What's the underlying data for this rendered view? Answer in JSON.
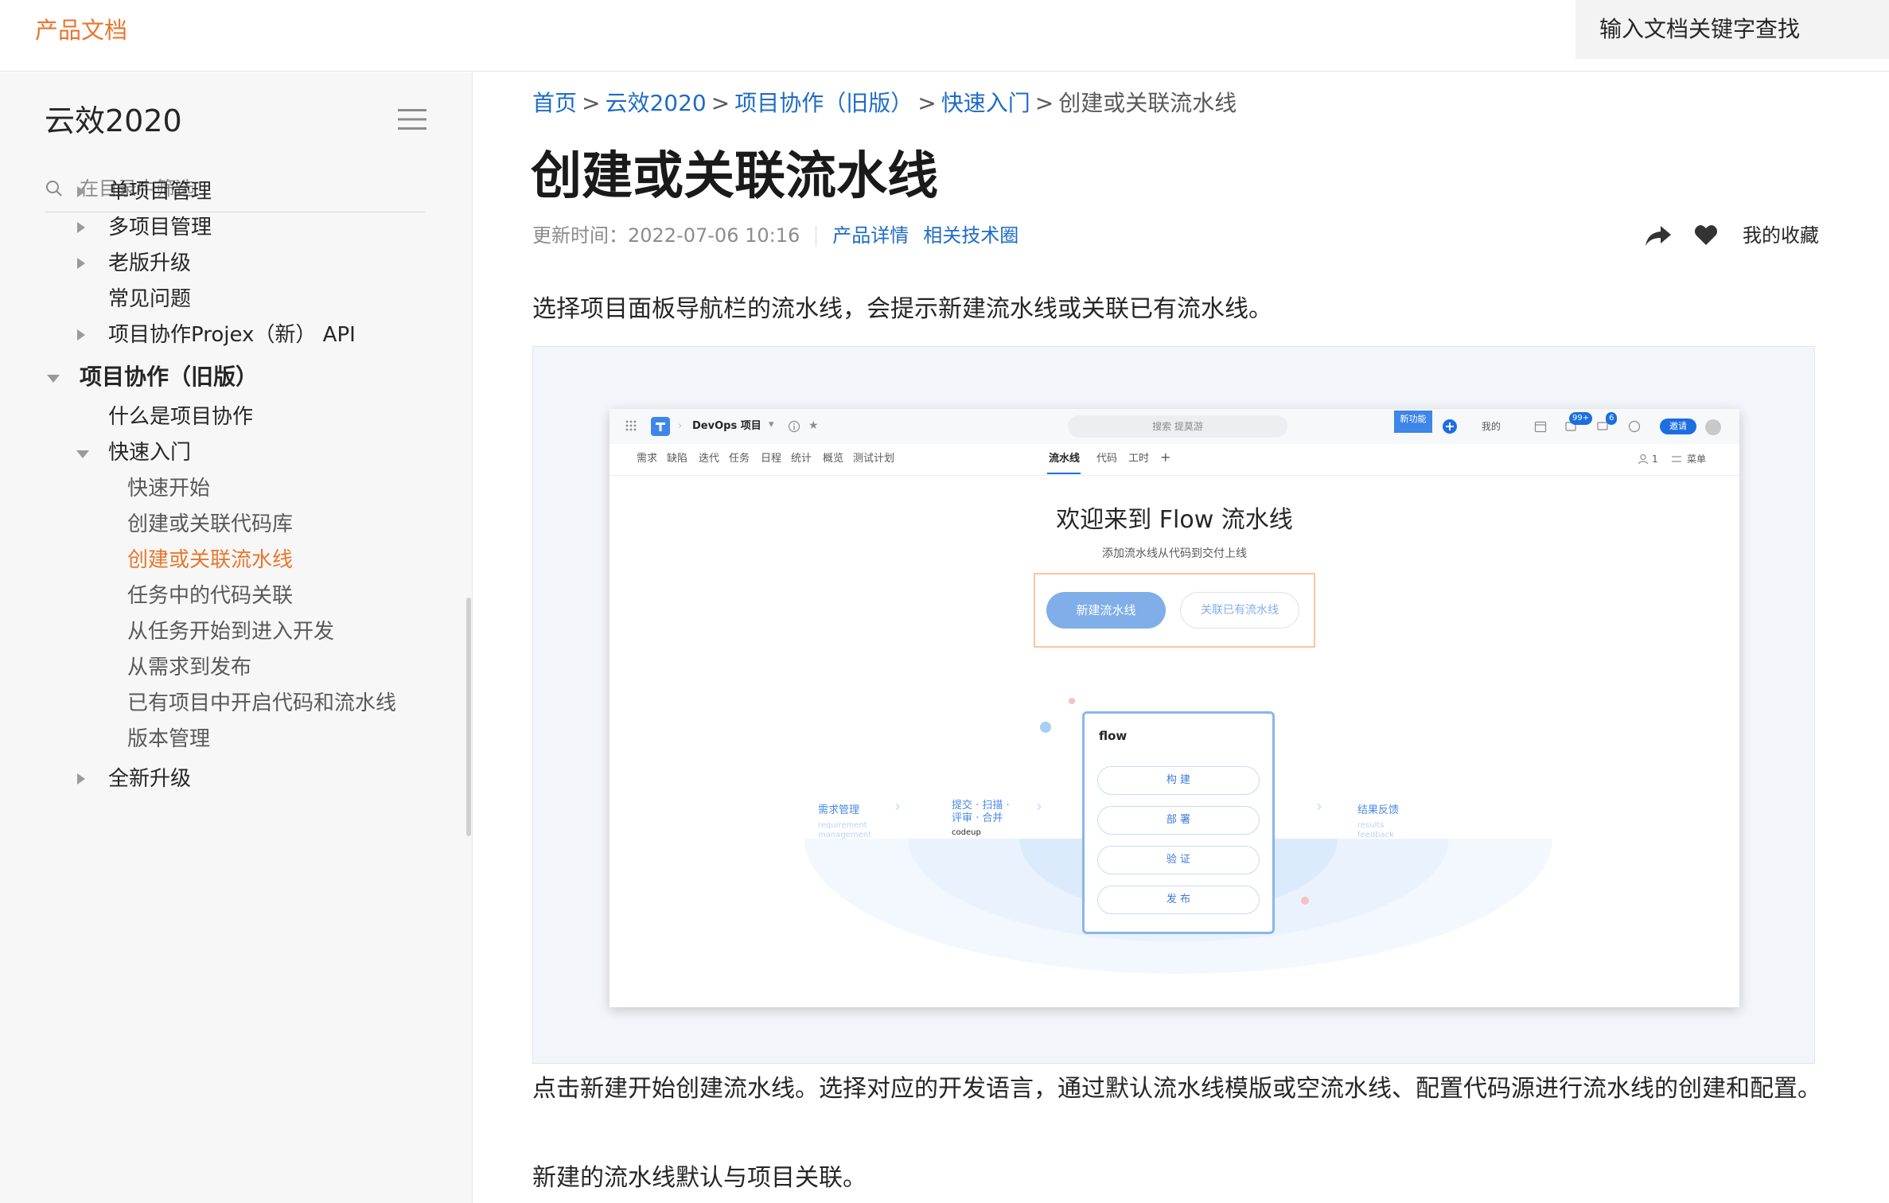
{
  "topbar": {
    "brand": "产品文档",
    "search_placeholder": "输入文档关键字查找"
  },
  "sidebar": {
    "title": "云效2020",
    "filter_placeholder": "在目录中筛选",
    "items": [
      {
        "label": "单项目管理"
      },
      {
        "label": "多项目管理"
      },
      {
        "label": "老版升级"
      },
      {
        "label": "常见问题"
      },
      {
        "label": "项目协作Projex（新） API"
      },
      {
        "label": "项目协作（旧版）"
      },
      {
        "label": "什么是项目协作"
      },
      {
        "label": "快速入门"
      },
      {
        "label": "快速开始"
      },
      {
        "label": "创建或关联代码库"
      },
      {
        "label": "创建或关联流水线"
      },
      {
        "label": "任务中的代码关联"
      },
      {
        "label": "从任务开始到进入开发"
      },
      {
        "label": "从需求到发布"
      },
      {
        "label": "已有项目中开启代码和流水线"
      },
      {
        "label": "版本管理"
      },
      {
        "label": "全新升级"
      }
    ]
  },
  "breadcrumb": {
    "home": "首页",
    "level1": "云效2020",
    "level2": "项目协作（旧版）",
    "level3": "快速入门",
    "current": "创建或关联流水线",
    "sep": ">"
  },
  "article": {
    "title": "创建或关联流水线",
    "updated": "更新时间：2022-07-06 10:16",
    "link_product": "产品详情",
    "link_community": "相关技术圈",
    "favorite": "我的收藏",
    "para1": "选择项目面板导航栏的流水线，会提示新建流水线或关联已有流水线。",
    "para2": "点击新建开始创建流水线。选择对应的开发语言，通过默认流水线模版或空流水线、配置代码源进行流水线的创建和配置。",
    "para3": "新建的流水线默认与项目关联。"
  },
  "screenshot": {
    "project": "DevOps 项目",
    "search": "搜索 提莫游",
    "new_feature": "新功能",
    "mine": "我的",
    "badge_notify": "99+",
    "badge_msg": "6",
    "invite": "邀请",
    "tabs": [
      "需求",
      "缺陷",
      "迭代",
      "任务",
      "日程",
      "统计",
      "概览",
      "测试计划",
      "流水线",
      "代码",
      "工时"
    ],
    "plus": "+",
    "member_count": "1",
    "menu": "菜单",
    "welcome_title": "欢迎来到 Flow 流水线",
    "welcome_sub": "添加流水线从代码到交付上线",
    "btn_new": "新建流水线",
    "btn_link": "关联已有流水线",
    "flow_logo": "flow",
    "flow_steps": [
      "构 建",
      "部 署",
      "验 证",
      "发 布"
    ],
    "left_label": "需求管理",
    "left_label_en1": "requirement",
    "left_label_en2": "management",
    "mid_label1": "提交 · 扫描 ·",
    "mid_label2": "评审 · 合并",
    "mid_label3": "codeup",
    "right_label": "结果反馈",
    "right_label_en1": "results",
    "right_label_en2": "feedback"
  },
  "colors": {
    "accent": "#e8772e",
    "link": "#1e6bc7",
    "primary_blue": "#1b6fe0"
  }
}
